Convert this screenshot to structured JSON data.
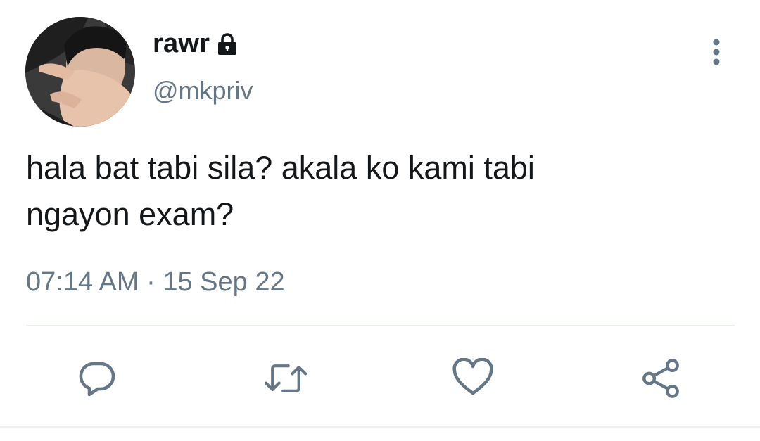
{
  "tweet": {
    "display_name": "rawr",
    "handle": "@mkpriv",
    "text_line1": "hala bat tabi sila? akala ko kami tabi",
    "text_line2": "ngayon exam?",
    "time": "07:14 AM",
    "separator": "·",
    "date": "15 Sep 22",
    "protected_icon": "lock-icon",
    "menu_icon": "more-vertical-icon"
  },
  "actions": [
    {
      "name": "reply",
      "icon": "reply-icon"
    },
    {
      "name": "retweet",
      "icon": "retweet-icon"
    },
    {
      "name": "like",
      "icon": "heart-icon"
    },
    {
      "name": "share",
      "icon": "share-icon"
    }
  ],
  "colors": {
    "text": "#14171a",
    "secondary": "#657786",
    "icon": "#657786",
    "divider": "#e6ecf0"
  }
}
